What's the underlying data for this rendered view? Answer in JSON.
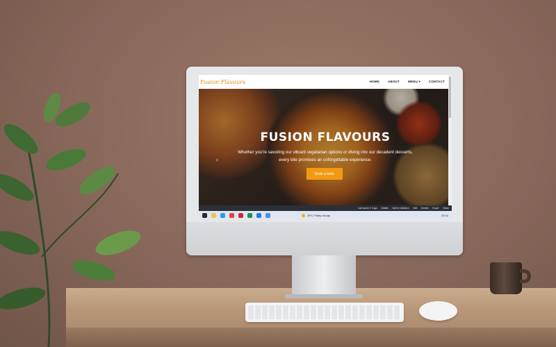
{
  "site": {
    "logo": "Fusion Flavours",
    "nav": [
      "HOME",
      "ABOUT",
      "MENU ▾",
      "CONTACT"
    ]
  },
  "hero": {
    "title": "FUSION FLAVOURS",
    "subtitle": "Whether you're savoring our vibrant vegetarian options or diving into our decadent desserts, every bite promises an unforgettable experience.",
    "button": "Book a table",
    "prev_arrow": "‹"
  },
  "notification_bar": {
    "items": [
      "Last saved: 2 h ago",
      "Details",
      "Add to Collection",
      "Edit",
      "Embed",
      "Export",
      "Share"
    ]
  },
  "taskbar": {
    "icons": [
      {
        "name": "start-icon",
        "color": "#2a2a2a"
      },
      {
        "name": "file-explorer-icon",
        "color": "#f2c14e"
      },
      {
        "name": "edge-icon",
        "color": "#2aa0d8"
      },
      {
        "name": "chrome-icon",
        "color": "#e54335"
      },
      {
        "name": "opera-icon",
        "color": "#d0253b"
      },
      {
        "name": "spreadsheet-icon",
        "color": "#1e8f4f"
      },
      {
        "name": "vscode-icon",
        "color": "#2a7bd6"
      },
      {
        "name": "chrome-profile-icon",
        "color": "#4a8ee8"
      }
    ],
    "weather": "29°C  Partly cloudy",
    "time": "20:10"
  }
}
